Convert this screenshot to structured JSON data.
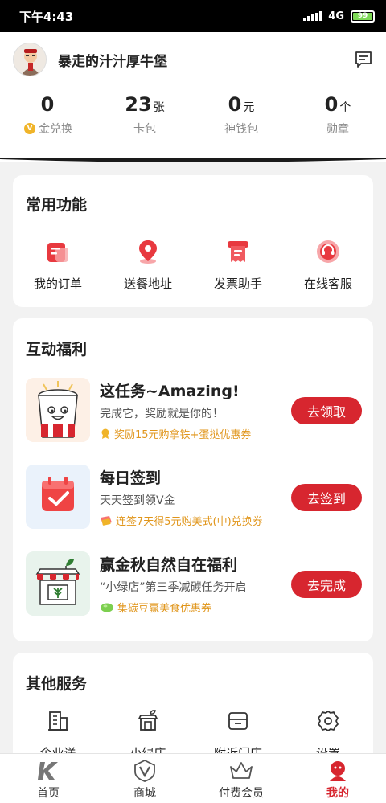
{
  "status_bar": {
    "time": "下午4:43",
    "network": "4G",
    "battery": "99",
    "battery_level": 0.99
  },
  "profile": {
    "username": "暴走的汁汁厚牛堡"
  },
  "stats": [
    {
      "value": "0",
      "unit": "",
      "label": "金兑换",
      "icon": "v-coin-icon"
    },
    {
      "value": "23",
      "unit": "张",
      "label": "卡包"
    },
    {
      "value": "0",
      "unit": "元",
      "label": "神钱包"
    },
    {
      "value": "0",
      "unit": "个",
      "label": "勋章"
    }
  ],
  "common_functions": {
    "title": "常用功能",
    "items": [
      {
        "label": "我的订单",
        "icon": "order-icon"
      },
      {
        "label": "送餐地址",
        "icon": "location-pin-icon"
      },
      {
        "label": "发票助手",
        "icon": "invoice-icon"
      },
      {
        "label": "在线客服",
        "icon": "headset-icon"
      }
    ]
  },
  "welfare": {
    "title": "互动福利",
    "tasks": [
      {
        "title": "这任务~Amazing!",
        "desc": "完成它，奖励就是你的！",
        "reward": "奖励15元购拿铁+蛋挞优惠券",
        "button": "去领取"
      },
      {
        "title": "每日签到",
        "desc": "天天签到领V金",
        "reward": "连签7天得5元购美式(中)兑换券",
        "button": "去签到"
      },
      {
        "title": "赢金秋自然自在福利",
        "desc": "“小绿店”第三季减碳任务开启",
        "reward": "集碳豆赢美食优惠券",
        "button": "去完成"
      }
    ]
  },
  "other_services": {
    "title": "其他服务",
    "items": [
      {
        "label": "企业送",
        "icon": "building-icon"
      },
      {
        "label": "小绿店",
        "icon": "green-store-icon"
      },
      {
        "label": "附近门店",
        "icon": "store-icon"
      },
      {
        "label": "设置",
        "icon": "gear-icon"
      }
    ]
  },
  "bottom_nav": [
    {
      "label": "首页",
      "icon": "k-logo-icon",
      "active": false
    },
    {
      "label": "商城",
      "icon": "v-shield-icon",
      "active": false
    },
    {
      "label": "付费会员",
      "icon": "crown-icon",
      "active": false
    },
    {
      "label": "我的",
      "icon": "profile-icon",
      "active": true
    }
  ],
  "colors": {
    "accent": "#d7262f",
    "reward": "#e0951a",
    "background": "#f2f2f2"
  }
}
